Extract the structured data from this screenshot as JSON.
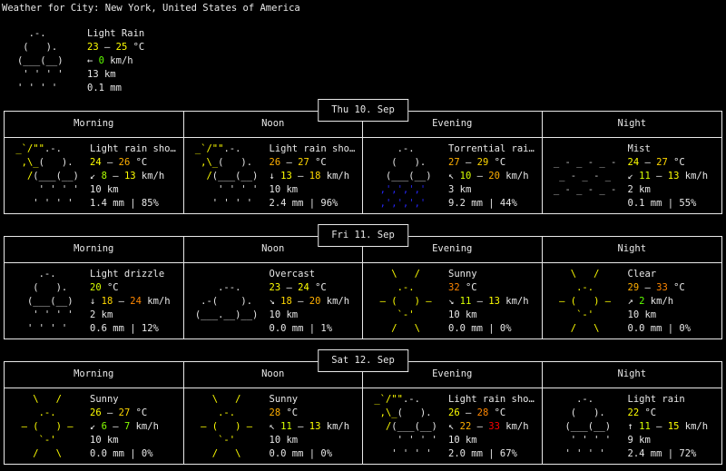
{
  "header": {
    "title": "Weather for City: New York, United States of America"
  },
  "colors": {
    "fg": "#e8e8e8",
    "sun": "#ffff00",
    "cl": "#e8e8e8",
    "fog": "#c6c6c6",
    "rainblue": "#2727ff",
    "y226": "#ffff00",
    "y220": "#ffd700",
    "o214": "#ffaf00",
    "o208": "#ff8700",
    "red": "#ff0000",
    "g190": "#d7ff00",
    "g154": "#afff00",
    "g118": "#87ff00",
    "g82": "#5fff00"
  },
  "icons": {
    "sunny": [
      [
        [
          "    \\   /   ",
          "sun"
        ]
      ],
      [
        [
          "     .-.     ",
          "sun"
        ]
      ],
      [
        [
          "  – (   ) –  ",
          "sun"
        ]
      ],
      [
        [
          "     `-'     ",
          "sun"
        ]
      ],
      [
        [
          "    /   \\   ",
          "sun"
        ]
      ]
    ],
    "lightrain": [
      [
        [
          "     .-.",
          "cl"
        ]
      ],
      [
        [
          "    (   ).",
          "cl"
        ]
      ],
      [
        [
          "   (___(__)",
          "cl"
        ]
      ],
      [
        [
          "    ' ' ' '",
          "cl"
        ]
      ],
      [
        [
          "   ' ' ' '",
          "cl"
        ]
      ]
    ],
    "lightshowers": [
      [
        [
          " _`/\"\"",
          "sun"
        ],
        [
          ".-.",
          "cl"
        ]
      ],
      [
        [
          "  ,\\_",
          "sun"
        ],
        [
          "(   ).",
          "cl"
        ]
      ],
      [
        [
          "   /",
          "sun"
        ],
        [
          "(___(__)",
          "cl"
        ]
      ],
      [
        [
          "     ' ' ' '",
          "cl"
        ]
      ],
      [
        [
          "    ' ' ' '",
          "cl"
        ]
      ]
    ],
    "heavyrain": [
      [
        [
          "     .-.",
          "cl"
        ]
      ],
      [
        [
          "    (   ).",
          "cl"
        ]
      ],
      [
        [
          "   (___(__)",
          "cl"
        ]
      ],
      [
        [
          "  ‚'‚'‚'‚'",
          "rainblue"
        ]
      ],
      [
        [
          "  ‚'‚'‚'‚'",
          "rainblue"
        ]
      ]
    ],
    "cloudy": [
      [
        [
          "",
          "cl"
        ]
      ],
      [
        [
          "     .--.",
          "cl"
        ]
      ],
      [
        [
          "  .-(    ).",
          "cl"
        ]
      ],
      [
        [
          " (___.__)__)",
          "cl"
        ]
      ],
      [
        [
          "",
          "cl"
        ]
      ]
    ],
    "fog": [
      [
        [
          "",
          "fog"
        ]
      ],
      [
        [
          " _ - _ - _ -",
          "fog"
        ]
      ],
      [
        [
          "  _ - _ - _",
          "fog"
        ]
      ],
      [
        [
          " _ - _ - _ -",
          "fog"
        ]
      ],
      [
        [
          "",
          "fog"
        ]
      ]
    ]
  },
  "current": {
    "icon": "lightrain",
    "lines": [
      [
        [
          "Light Rain",
          "fg"
        ]
      ],
      [
        [
          "23",
          "y226"
        ],
        [
          " – ",
          "fg"
        ],
        [
          "25",
          "y226"
        ],
        [
          " °C",
          "fg"
        ]
      ],
      [
        [
          "← ",
          "fg"
        ],
        [
          "0",
          "g82"
        ],
        [
          " km/h",
          "fg"
        ]
      ],
      [
        [
          "13 km",
          "fg"
        ]
      ],
      [
        [
          "0.1 mm",
          "fg"
        ]
      ]
    ]
  },
  "days": [
    {
      "title": "Thu 10. Sep",
      "columns": [
        "Morning",
        "Noon",
        "Evening",
        "Night"
      ],
      "cells": [
        {
          "icon": "lightshowers",
          "lines": [
            [
              [
                "Light rain sho…",
                "fg"
              ]
            ],
            [
              [
                "24",
                "y226"
              ],
              [
                " – ",
                "fg"
              ],
              [
                "26",
                "o214"
              ],
              [
                " °C",
                "fg"
              ]
            ],
            [
              [
                "↙ ",
                "fg"
              ],
              [
                "8",
                "g154"
              ],
              [
                " – ",
                "fg"
              ],
              [
                "13",
                "y226"
              ],
              [
                " km/h",
                "fg"
              ]
            ],
            [
              [
                "10 km",
                "fg"
              ]
            ],
            [
              [
                "1.4 mm | 85%",
                "fg"
              ]
            ]
          ]
        },
        {
          "icon": "lightshowers",
          "lines": [
            [
              [
                "Light rain sho…",
                "fg"
              ]
            ],
            [
              [
                "26",
                "o214"
              ],
              [
                " – ",
                "fg"
              ],
              [
                "27",
                "y220"
              ],
              [
                " °C",
                "fg"
              ]
            ],
            [
              [
                "↓ ",
                "fg"
              ],
              [
                "13",
                "y226"
              ],
              [
                " – ",
                "fg"
              ],
              [
                "18",
                "y220"
              ],
              [
                " km/h",
                "fg"
              ]
            ],
            [
              [
                "10 km",
                "fg"
              ]
            ],
            [
              [
                "2.4 mm | 96%",
                "fg"
              ]
            ]
          ]
        },
        {
          "icon": "heavyrain",
          "lines": [
            [
              [
                "Torrential rai…",
                "fg"
              ]
            ],
            [
              [
                "27",
                "o214"
              ],
              [
                " – ",
                "fg"
              ],
              [
                "29",
                "y220"
              ],
              [
                " °C",
                "fg"
              ]
            ],
            [
              [
                "↖ ",
                "fg"
              ],
              [
                "10",
                "g190"
              ],
              [
                " – ",
                "fg"
              ],
              [
                "20",
                "o214"
              ],
              [
                " km/h",
                "fg"
              ]
            ],
            [
              [
                "3 km",
                "fg"
              ]
            ],
            [
              [
                "9.2 mm | 44%",
                "fg"
              ]
            ]
          ]
        },
        {
          "icon": "fog",
          "lines": [
            [
              [
                "Mist",
                "fg"
              ]
            ],
            [
              [
                "24",
                "y226"
              ],
              [
                " – ",
                "fg"
              ],
              [
                "27",
                "y220"
              ],
              [
                " °C",
                "fg"
              ]
            ],
            [
              [
                "↙ ",
                "fg"
              ],
              [
                "11",
                "g190"
              ],
              [
                " – ",
                "fg"
              ],
              [
                "13",
                "y226"
              ],
              [
                " km/h",
                "fg"
              ]
            ],
            [
              [
                "2 km",
                "fg"
              ]
            ],
            [
              [
                "0.1 mm | 55%",
                "fg"
              ]
            ]
          ]
        }
      ]
    },
    {
      "title": "Fri 11. Sep",
      "columns": [
        "Morning",
        "Noon",
        "Evening",
        "Night"
      ],
      "cells": [
        {
          "icon": "lightrain",
          "lines": [
            [
              [
                "Light drizzle",
                "fg"
              ]
            ],
            [
              [
                "20",
                "g190"
              ],
              [
                " °C",
                "fg"
              ]
            ],
            [
              [
                "↓ ",
                "fg"
              ],
              [
                "18",
                "y220"
              ],
              [
                " – ",
                "fg"
              ],
              [
                "24",
                "o208"
              ],
              [
                " km/h",
                "fg"
              ]
            ],
            [
              [
                "2 km",
                "fg"
              ]
            ],
            [
              [
                "0.6 mm | 12%",
                "fg"
              ]
            ]
          ]
        },
        {
          "icon": "cloudy",
          "lines": [
            [
              [
                "Overcast",
                "fg"
              ]
            ],
            [
              [
                "23",
                "y226"
              ],
              [
                " – ",
                "fg"
              ],
              [
                "24",
                "y226"
              ],
              [
                " °C",
                "fg"
              ]
            ],
            [
              [
                "↘ ",
                "fg"
              ],
              [
                "18",
                "y220"
              ],
              [
                " – ",
                "fg"
              ],
              [
                "20",
                "o214"
              ],
              [
                " km/h",
                "fg"
              ]
            ],
            [
              [
                "10 km",
                "fg"
              ]
            ],
            [
              [
                "0.0 mm | 1%",
                "fg"
              ]
            ]
          ]
        },
        {
          "icon": "sunny",
          "lines": [
            [
              [
                "Sunny",
                "fg"
              ]
            ],
            [
              [
                "32",
                "o208"
              ],
              [
                " °C",
                "fg"
              ]
            ],
            [
              [
                "↘ ",
                "fg"
              ],
              [
                "11",
                "g190"
              ],
              [
                " – ",
                "fg"
              ],
              [
                "13",
                "y226"
              ],
              [
                " km/h",
                "fg"
              ]
            ],
            [
              [
                "10 km",
                "fg"
              ]
            ],
            [
              [
                "0.0 mm | 0%",
                "fg"
              ]
            ]
          ]
        },
        {
          "icon": "sunny",
          "lines": [
            [
              [
                "Clear",
                "fg"
              ]
            ],
            [
              [
                "29",
                "o214"
              ],
              [
                " – ",
                "fg"
              ],
              [
                "33",
                "o208"
              ],
              [
                " °C",
                "fg"
              ]
            ],
            [
              [
                "↗ ",
                "fg"
              ],
              [
                "2",
                "g82"
              ],
              [
                " km/h",
                "fg"
              ]
            ],
            [
              [
                "10 km",
                "fg"
              ]
            ],
            [
              [
                "0.0 mm | 0%",
                "fg"
              ]
            ]
          ]
        }
      ]
    },
    {
      "title": "Sat 12. Sep",
      "columns": [
        "Morning",
        "Noon",
        "Evening",
        "Night"
      ],
      "cells": [
        {
          "icon": "sunny",
          "lines": [
            [
              [
                "Sunny",
                "fg"
              ]
            ],
            [
              [
                "26",
                "y226"
              ],
              [
                " – ",
                "fg"
              ],
              [
                "27",
                "y220"
              ],
              [
                " °C",
                "fg"
              ]
            ],
            [
              [
                "↙ ",
                "fg"
              ],
              [
                "6",
                "g118"
              ],
              [
                " – ",
                "fg"
              ],
              [
                "7",
                "g118"
              ],
              [
                " km/h",
                "fg"
              ]
            ],
            [
              [
                "10 km",
                "fg"
              ]
            ],
            [
              [
                "0.0 mm | 0%",
                "fg"
              ]
            ]
          ]
        },
        {
          "icon": "sunny",
          "lines": [
            [
              [
                "Sunny",
                "fg"
              ]
            ],
            [
              [
                "28",
                "o214"
              ],
              [
                " °C",
                "fg"
              ]
            ],
            [
              [
                "↖ ",
                "fg"
              ],
              [
                "11",
                "g190"
              ],
              [
                " – ",
                "fg"
              ],
              [
                "13",
                "y226"
              ],
              [
                " km/h",
                "fg"
              ]
            ],
            [
              [
                "10 km",
                "fg"
              ]
            ],
            [
              [
                "0.0 mm | 0%",
                "fg"
              ]
            ]
          ]
        },
        {
          "icon": "lightshowers",
          "lines": [
            [
              [
                "Light rain sho…",
                "fg"
              ]
            ],
            [
              [
                "26",
                "y226"
              ],
              [
                " – ",
                "fg"
              ],
              [
                "28",
                "o208"
              ],
              [
                " °C",
                "fg"
              ]
            ],
            [
              [
                "↖ ",
                "fg"
              ],
              [
                "22",
                "o214"
              ],
              [
                " – ",
                "fg"
              ],
              [
                "33",
                "red"
              ],
              [
                " km/h",
                "fg"
              ]
            ],
            [
              [
                "10 km",
                "fg"
              ]
            ],
            [
              [
                "2.0 mm | 67%",
                "fg"
              ]
            ]
          ]
        },
        {
          "icon": "lightrain",
          "lines": [
            [
              [
                "Light rain",
                "fg"
              ]
            ],
            [
              [
                "22",
                "y226"
              ],
              [
                " °C",
                "fg"
              ]
            ],
            [
              [
                "↑ ",
                "fg"
              ],
              [
                "11",
                "g190"
              ],
              [
                " – ",
                "fg"
              ],
              [
                "15",
                "y226"
              ],
              [
                " km/h",
                "fg"
              ]
            ],
            [
              [
                "9 km",
                "fg"
              ]
            ],
            [
              [
                "2.4 mm | 72%",
                "fg"
              ]
            ]
          ]
        }
      ]
    }
  ]
}
